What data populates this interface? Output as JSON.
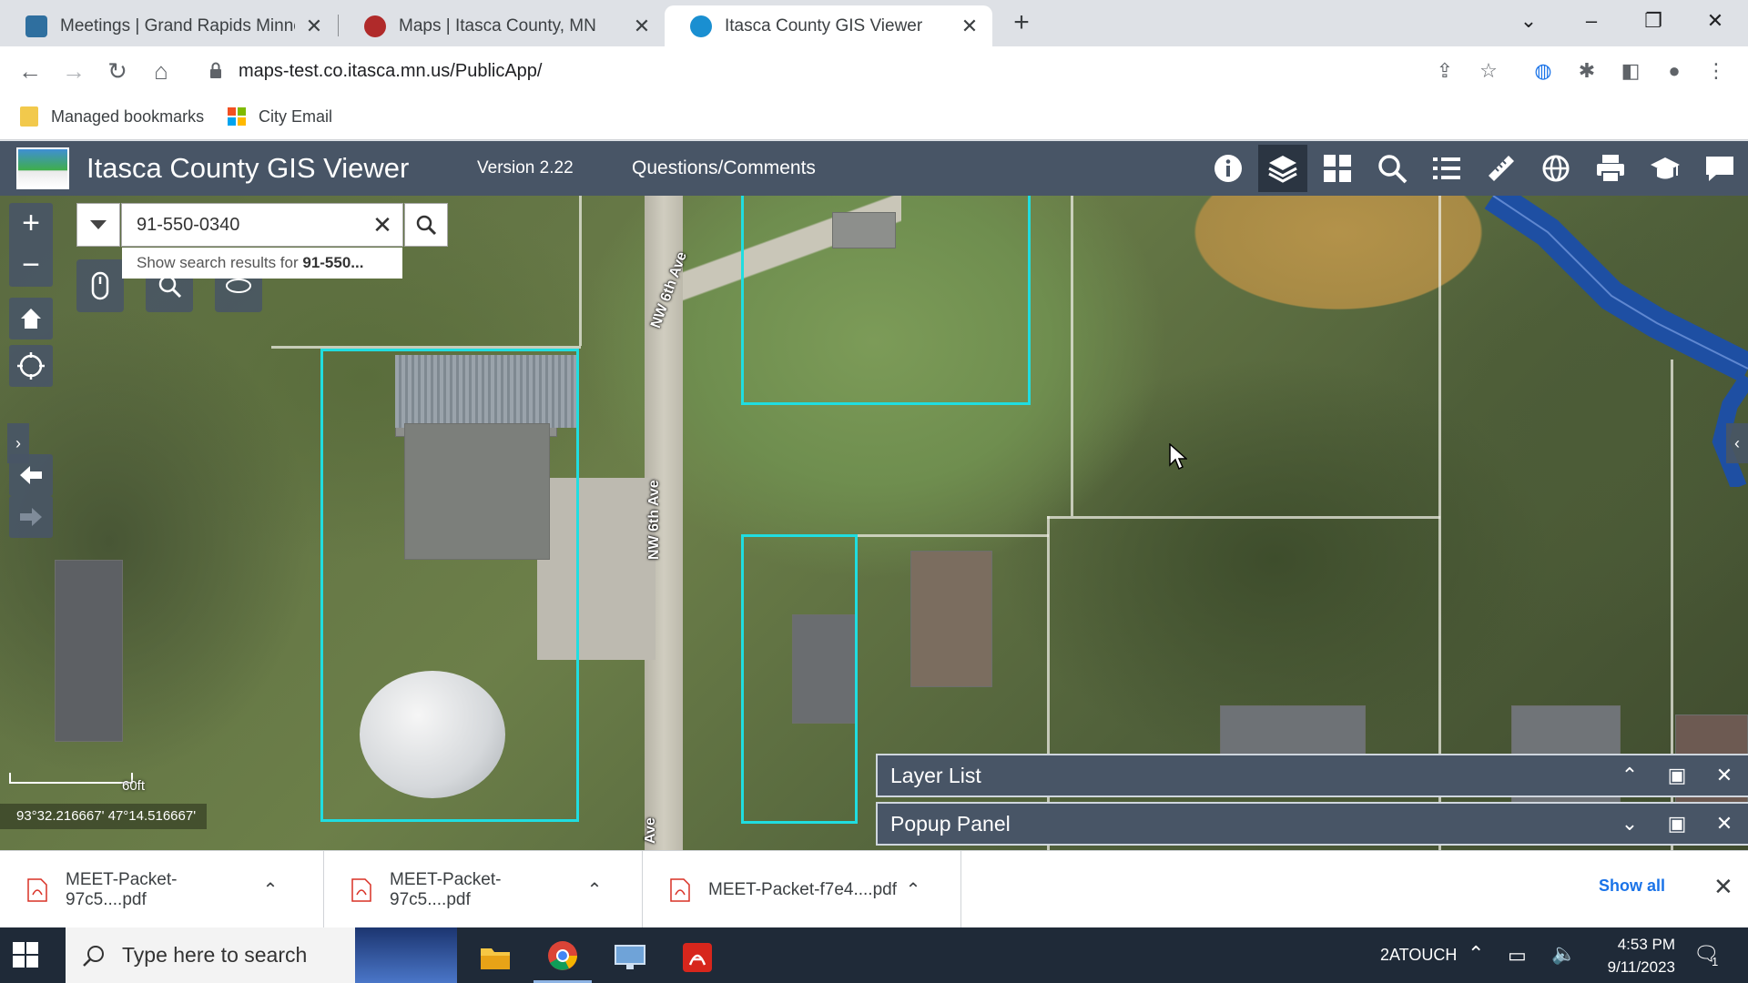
{
  "browser": {
    "tabs": [
      {
        "title": "Meetings | Grand Rapids Minneso",
        "close": "✕",
        "active": false,
        "favicon_color": "#2f6f9f"
      },
      {
        "title": "Maps | Itasca County, MN",
        "close": "✕",
        "active": false,
        "favicon_color": "#b02a2a"
      },
      {
        "title": "Itasca County GIS Viewer",
        "close": "✕",
        "active": true,
        "favicon_color": "#1a8fd1"
      }
    ],
    "new_tab": "+",
    "window_controls": {
      "tab_search": "⌄",
      "minimize": "–",
      "restore": "❐",
      "close": "✕"
    },
    "url": "maps-test.co.itasca.mn.us/PublicApp/",
    "bookmarks": [
      {
        "label": "Managed bookmarks",
        "icon": "folder-icon"
      },
      {
        "label": "City Email",
        "icon": "microsoft-icon"
      }
    ]
  },
  "app": {
    "title": "Itasca County GIS Viewer",
    "version": "Version 2.22",
    "link": "Questions/Comments",
    "tools": [
      {
        "name": "about",
        "icon": "info-icon",
        "active": false
      },
      {
        "name": "layer-list",
        "icon": "layers-icon",
        "active": true
      },
      {
        "name": "basemap-gallery",
        "icon": "grid-icon",
        "active": false
      },
      {
        "name": "search",
        "icon": "search-icon",
        "active": false
      },
      {
        "name": "legend",
        "icon": "legend-list-icon",
        "active": false
      },
      {
        "name": "measure",
        "icon": "ruler-icon",
        "active": false
      },
      {
        "name": "themes",
        "icon": "globe-icon",
        "active": false
      },
      {
        "name": "print",
        "icon": "printer-icon",
        "active": false
      },
      {
        "name": "tutorial",
        "icon": "graduation-cap-icon",
        "active": false
      },
      {
        "name": "comments",
        "icon": "chat-icon",
        "active": false
      }
    ],
    "accent_color": "#485566"
  },
  "map": {
    "search": {
      "value": "91-550-0340",
      "suggestion_prefix": "Show search results for ",
      "suggestion_term": "91-550..."
    },
    "zoom_in": "+",
    "zoom_out": "−",
    "road_labels": [
      "NW 6th Ave",
      "NW 6th Ave",
      "Ave"
    ],
    "scale_label": "60ft",
    "coordinates": "93°32.216667' 47°14.516667'",
    "parcel_color": "#20dde0"
  },
  "panels": [
    {
      "title": "Layer List",
      "collapse_icon": "⌃",
      "maximize_icon": "▣",
      "close_icon": "✕"
    },
    {
      "title": "Popup Panel",
      "collapse_icon": "⌄",
      "maximize_icon": "▣",
      "close_icon": "✕"
    }
  ],
  "downloads": {
    "items": [
      {
        "name": "MEET-Packet-97c5....pdf",
        "caret": "⌃"
      },
      {
        "name": "MEET-Packet-97c5....pdf",
        "caret": "⌃"
      },
      {
        "name": "MEET-Packet-f7e4....pdf",
        "caret": "⌃"
      }
    ],
    "show_all": "Show all",
    "close": "✕"
  },
  "taskbar": {
    "search_placeholder": "Type here to search",
    "tray_label": "2ATOUCH",
    "time": "4:53 PM",
    "date": "9/11/2023",
    "notification_count": "1"
  }
}
